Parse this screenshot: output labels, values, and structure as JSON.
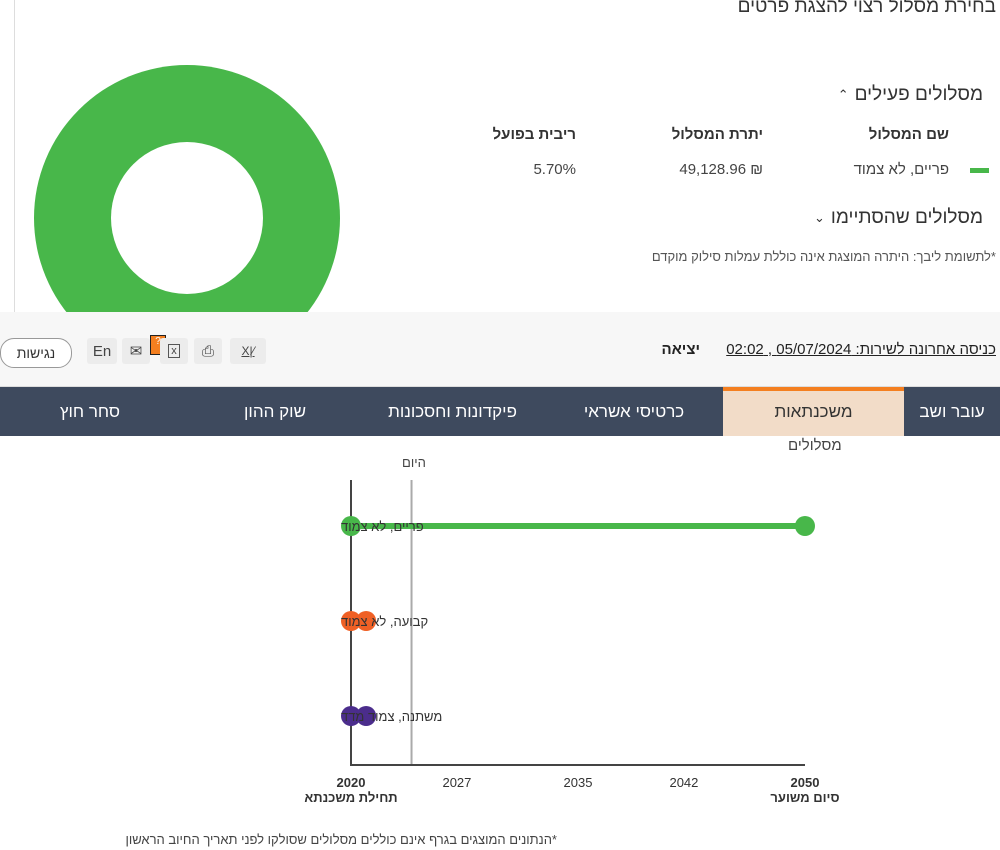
{
  "page": {
    "select_prompt": "בחירת מסלול רצוי להצגת פרטים",
    "active_tracks_title": "מסלולים פעילים",
    "ended_tracks_title": "מסלולים שהסתיימו",
    "table": {
      "headers": [
        "שם המסלול",
        "יתרת המסלול",
        "ריבית בפועל"
      ],
      "rows": [
        {
          "name": "פריים, לא צמוד",
          "balance": "49,128.96 ₪",
          "rate": "5.70%",
          "color": "#48b74a"
        }
      ]
    },
    "note": "*לתשומת ליבך: היתרה המוצגת אינה כוללת עמלות סילוק מוקדם",
    "donut_color": "#48b74a"
  },
  "header": {
    "last_login": "כניסה אחרונה לשירות: 05/07/2024 , 02:02",
    "logout": "יציאה",
    "language": "En",
    "accessibility": "נגישות",
    "help_badge": "?"
  },
  "nav": {
    "items": [
      "עובר ושב",
      "משכנתאות",
      "כרטיסי אשראי",
      "פיקדונות וחסכונות",
      "שוק ההון",
      "סחר חוץ"
    ],
    "active": "משכנתאות",
    "accent": "#f47f20"
  },
  "chart_data": {
    "type": "timeline",
    "title": "מסלולים",
    "today_label": "היום",
    "today": 2024,
    "xlim": [
      2020,
      2050
    ],
    "ticks": [
      "2020",
      "2027",
      "2035",
      "2042",
      "2050"
    ],
    "start_label": "תחילת משכנתא",
    "end_label": "סיום משוער",
    "series": [
      {
        "name": "פריים, לא צמוד",
        "start": 2020,
        "end": 2050,
        "color": "#48b74a"
      },
      {
        "name": "קבועה, לא צמוד",
        "start": 2020,
        "end": 2021,
        "color": "#ef6025"
      },
      {
        "name": "משתנה, צמוד מדד",
        "start": 2020,
        "end": 2021,
        "color": "#4b2d8c"
      }
    ],
    "footnote": "*הנתונים המוצגים בגרף אינם כוללים מסלולים שסולקו לפני תאריך החיוב הראשון"
  }
}
